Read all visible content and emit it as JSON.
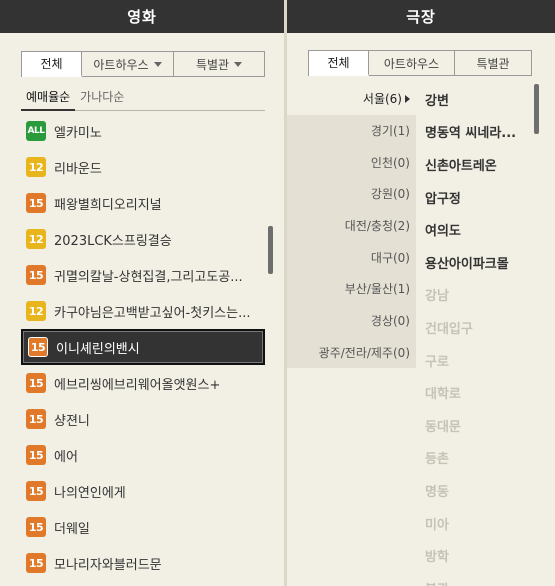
{
  "movie_panel": {
    "title": "영화",
    "tabs": [
      {
        "label": "전체",
        "active": true,
        "dropdown": false
      },
      {
        "label": "아트하우스",
        "active": false,
        "dropdown": true
      },
      {
        "label": "특별관",
        "active": false,
        "dropdown": true
      }
    ],
    "sort": [
      {
        "label": "예매율순",
        "active": true
      },
      {
        "label": "가나다순",
        "active": false
      }
    ],
    "movies": [
      {
        "rating": "ALL",
        "title": "엘카미노",
        "selected": false
      },
      {
        "rating": "12",
        "title": "리바운드",
        "selected": false
      },
      {
        "rating": "15",
        "title": "패왕별희디오리지널",
        "selected": false
      },
      {
        "rating": "12",
        "title": "2023LCK스프링결승",
        "selected": false
      },
      {
        "rating": "15",
        "title": "귀멸의칼날-상현집결,그리고도공...",
        "selected": false
      },
      {
        "rating": "12",
        "title": "카구야님은고백받고싶어-첫키스는...",
        "selected": false
      },
      {
        "rating": "15",
        "title": "이니셰린의밴시",
        "selected": true
      },
      {
        "rating": "15",
        "title": "에브리씽에브리웨어올앳원스+",
        "selected": false
      },
      {
        "rating": "15",
        "title": "샹젼니",
        "selected": false
      },
      {
        "rating": "15",
        "title": "에어",
        "selected": false
      },
      {
        "rating": "15",
        "title": "나의연인에게",
        "selected": false
      },
      {
        "rating": "15",
        "title": "더웨일",
        "selected": false
      },
      {
        "rating": "15",
        "title": "모나리자와블러드문",
        "selected": false
      }
    ]
  },
  "theater_panel": {
    "title": "극장",
    "tabs": [
      {
        "label": "전체",
        "active": true
      },
      {
        "label": "아트하우스",
        "active": false
      },
      {
        "label": "특별관",
        "active": false
      }
    ],
    "regions": [
      {
        "label": "서울(6)",
        "active": true
      },
      {
        "label": "경기(1)",
        "active": false
      },
      {
        "label": "인천(0)",
        "active": false
      },
      {
        "label": "강원(0)",
        "active": false
      },
      {
        "label": "대전/충청(2)",
        "active": false
      },
      {
        "label": "대구(0)",
        "active": false
      },
      {
        "label": "부산/울산(1)",
        "active": false
      },
      {
        "label": "경상(0)",
        "active": false
      },
      {
        "label": "광주/전라/제주(0)",
        "active": false
      }
    ],
    "theaters": [
      {
        "name": "강변",
        "enabled": true
      },
      {
        "name": "명동역 씨네라...",
        "enabled": true
      },
      {
        "name": "신촌아트레온",
        "enabled": true
      },
      {
        "name": "압구정",
        "enabled": true
      },
      {
        "name": "여의도",
        "enabled": true
      },
      {
        "name": "용산아이파크몰",
        "enabled": true
      },
      {
        "name": "강남",
        "enabled": false
      },
      {
        "name": "건대입구",
        "enabled": false
      },
      {
        "name": "구로",
        "enabled": false
      },
      {
        "name": "대학로",
        "enabled": false
      },
      {
        "name": "동대문",
        "enabled": false
      },
      {
        "name": "등촌",
        "enabled": false
      },
      {
        "name": "명동",
        "enabled": false
      },
      {
        "name": "미아",
        "enabled": false
      },
      {
        "name": "방학",
        "enabled": false
      },
      {
        "name": "불광",
        "enabled": false
      }
    ]
  },
  "colors": {
    "header_bg": "#333333",
    "panel_bg": "#f2f0e5",
    "rating_all": "#2a9b3a",
    "rating_12": "#e8b51d",
    "rating_15": "#e07a2a",
    "disabled_text": "#c6c3b6"
  }
}
